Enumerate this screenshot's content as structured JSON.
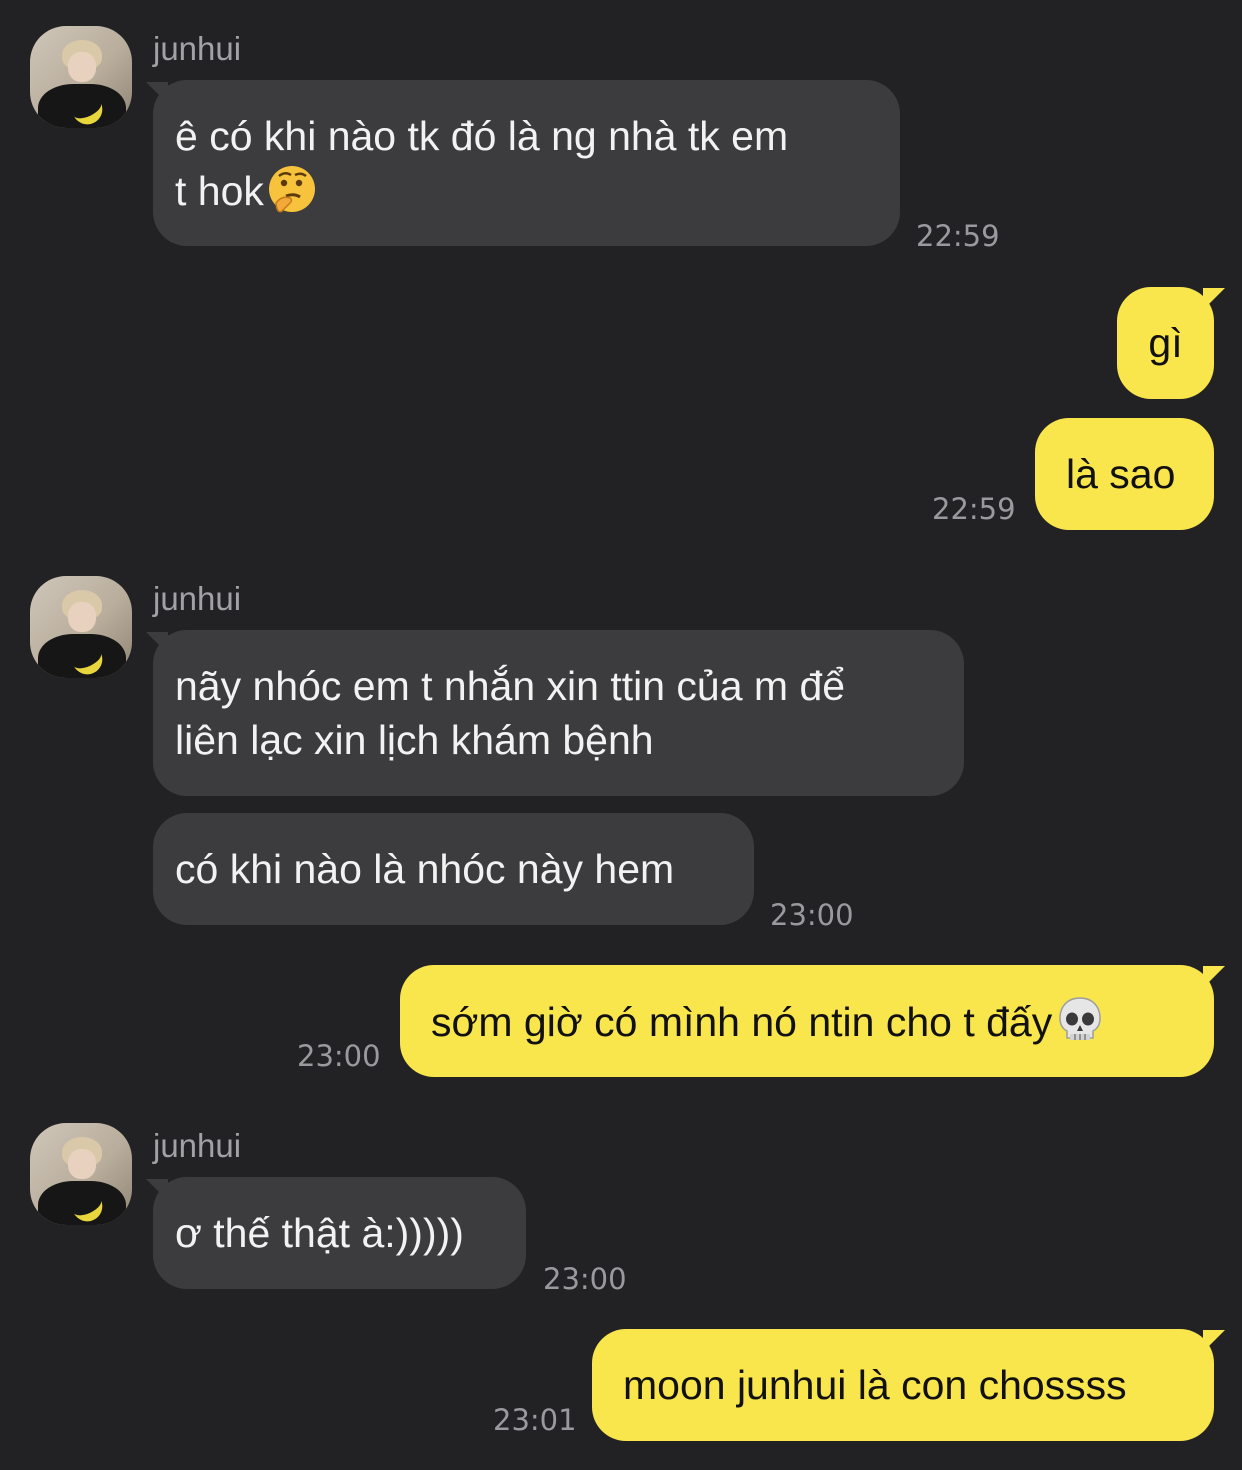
{
  "contact": {
    "name": "junhui"
  },
  "messages": [
    {
      "from": "them",
      "text_line1": "ê có khi nào tk đó là ng nhà tk em",
      "text_line2": "t hok",
      "emoji": "thinking-face-emoji",
      "time": "22:59"
    },
    {
      "from": "me",
      "text": "gì"
    },
    {
      "from": "me",
      "text": "là sao",
      "time": "22:59"
    },
    {
      "from": "them",
      "text_line1": "nãy nhóc em t nhắn xin ttin của m để",
      "text_line2": "liên lạc xin lịch khám bệnh"
    },
    {
      "from": "them",
      "text": "có khi nào là nhóc này hem",
      "time": "23:00"
    },
    {
      "from": "me",
      "text": "sớm giờ có mình nó ntin cho t đấy",
      "emoji": "skull-emoji",
      "time": "23:00"
    },
    {
      "from": "them",
      "text": "ơ thế thật à:)))))",
      "time": "23:00"
    },
    {
      "from": "me",
      "text": "moon junhui là con chossss",
      "time": "23:01"
    }
  ],
  "colors": {
    "background": "#222224",
    "incoming_bubble": "#3c3c3e",
    "outgoing_bubble": "#f9e54c",
    "sender_name": "#a2a2a6",
    "timestamp": "#9a9a9e"
  }
}
